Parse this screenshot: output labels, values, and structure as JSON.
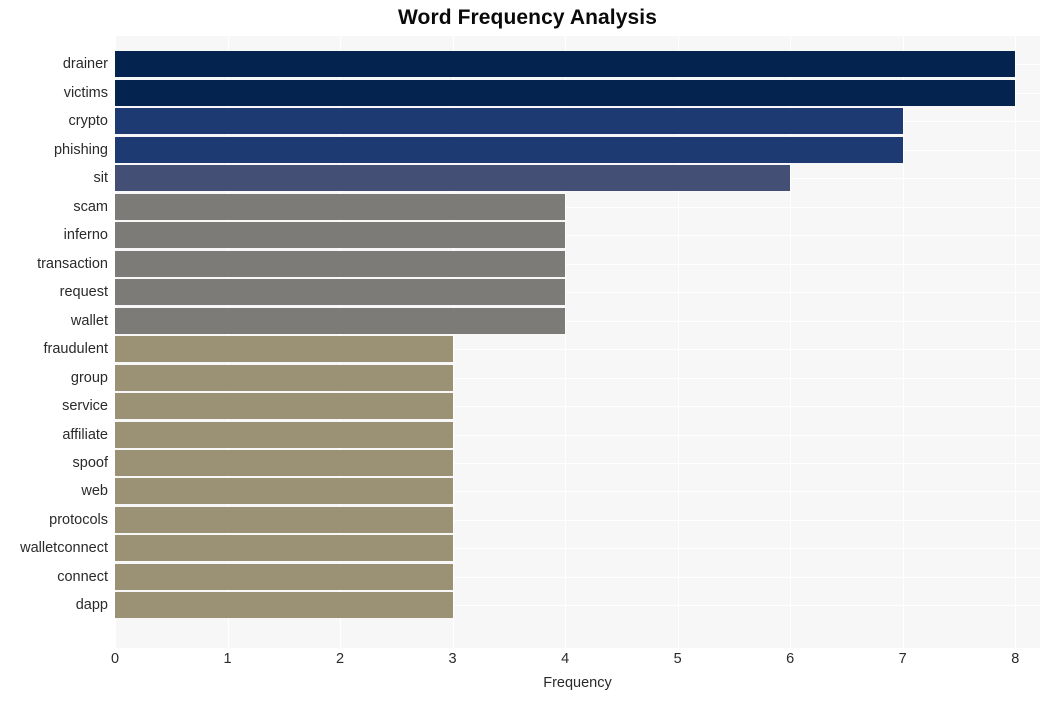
{
  "chart_data": {
    "type": "bar",
    "orientation": "horizontal",
    "title": "Word Frequency Analysis",
    "xlabel": "Frequency",
    "ylabel": "",
    "xlim": [
      0,
      8.22
    ],
    "xticks": [
      0,
      1,
      2,
      3,
      4,
      5,
      6,
      7,
      8
    ],
    "xtick_labels": [
      "0",
      "1",
      "2",
      "3",
      "4",
      "5",
      "6",
      "7",
      "8"
    ],
    "grid": true,
    "legend": null,
    "categories": [
      "drainer",
      "victims",
      "crypto",
      "phishing",
      "sit",
      "scam",
      "inferno",
      "transaction",
      "request",
      "wallet",
      "fraudulent",
      "group",
      "service",
      "affiliate",
      "spoof",
      "web",
      "protocols",
      "walletconnect",
      "connect",
      "dapp"
    ],
    "values": [
      8,
      8,
      7,
      7,
      6,
      4,
      4,
      4,
      4,
      4,
      3,
      3,
      3,
      3,
      3,
      3,
      3,
      3,
      3,
      3
    ],
    "bar_colors": [
      "#04244f",
      "#04244f",
      "#1e3a72",
      "#1e3a72",
      "#434f74",
      "#7c7b77",
      "#7c7b77",
      "#7c7b77",
      "#7c7b77",
      "#7c7b77",
      "#9b9175",
      "#9b9175",
      "#9b9175",
      "#9b9175",
      "#9b9175",
      "#9b9175",
      "#9b9175",
      "#9b9175",
      "#9b9175",
      "#9b9175"
    ],
    "plot_background": "#f7f7f7",
    "grid_color": "#ffffff",
    "figure_background": "#ffffff"
  }
}
